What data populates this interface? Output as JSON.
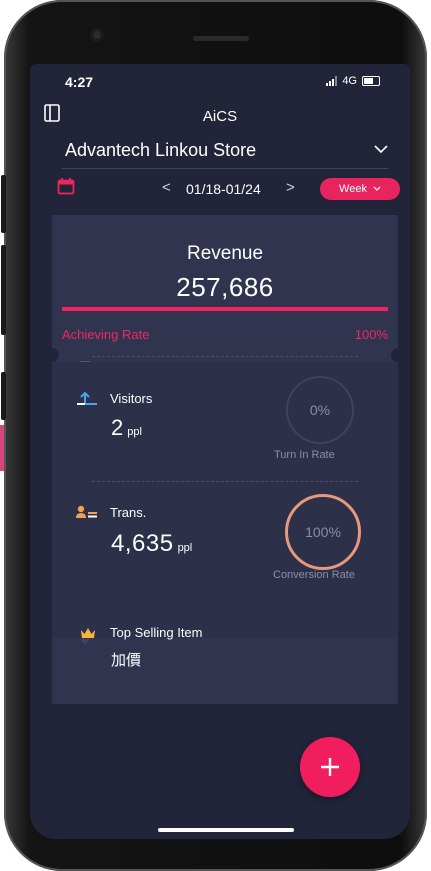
{
  "status_bar": {
    "time": "4:27",
    "network": "4G"
  },
  "app": {
    "title": "AiCS"
  },
  "store": {
    "name": "Advantech Linkou Store"
  },
  "date_nav": {
    "prev": "<",
    "range": "01/18-01/24",
    "next": ">",
    "period": "Week"
  },
  "revenue": {
    "title": "Revenue",
    "value": "257,686",
    "achieving_label": "Achieving Rate",
    "achieving_value": "100%",
    "achieving_fraction": 1.0
  },
  "visitors": {
    "label": "Visitors",
    "value": "2",
    "unit": "ppl",
    "rate_value": "0%",
    "rate_label": "Turn In Rate"
  },
  "transactions": {
    "label": "Trans.",
    "value": "4,635",
    "unit": "ppl",
    "rate_value": "100%",
    "rate_label": "Conversion Rate"
  },
  "top_selling": {
    "label": "Top Selling Item",
    "value": "加價"
  },
  "colors": {
    "accent": "#f01e5e",
    "background": "#22253a",
    "card": "#30344f",
    "conversion_ring": "#e6997d"
  },
  "icons": [
    "panel-icon",
    "chevron-down-icon",
    "calendar-icon",
    "visitors-icon",
    "transactions-icon",
    "crown-icon",
    "plus-icon"
  ]
}
